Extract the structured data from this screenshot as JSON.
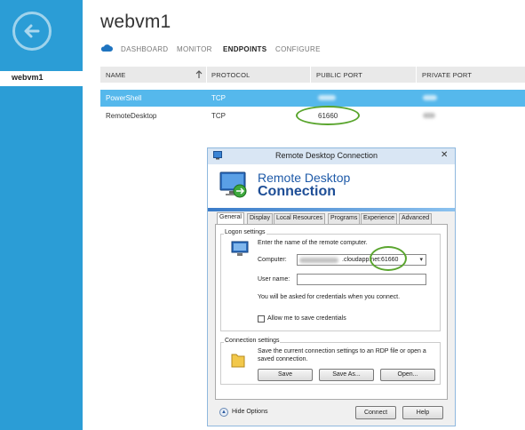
{
  "sidebar": {
    "back_icon": "back-arrow-icon",
    "selected_item": "webvm1"
  },
  "header": {
    "title": "webvm1",
    "tabs": [
      {
        "label": "DASHBOARD"
      },
      {
        "label": "MONITOR"
      },
      {
        "label": "ENDPOINTS"
      },
      {
        "label": "CONFIGURE"
      }
    ],
    "active_tab": "ENDPOINTS"
  },
  "table": {
    "columns": [
      "NAME",
      "PROTOCOL",
      "PUBLIC PORT",
      "PRIVATE PORT"
    ],
    "rows": [
      {
        "name": "PowerShell",
        "protocol": "TCP",
        "public_port": "",
        "private_port": ""
      },
      {
        "name": "RemoteDesktop",
        "protocol": "TCP",
        "public_port": "61660",
        "private_port": ""
      }
    ]
  },
  "dialog": {
    "title": "Remote Desktop Connection",
    "banner_line1": "Remote Desktop",
    "banner_line2": "Connection",
    "tabs": [
      "General",
      "Display",
      "Local Resources",
      "Programs",
      "Experience",
      "Advanced"
    ],
    "logon": {
      "group_label": "Logon settings",
      "instruction": "Enter the name of the remote computer.",
      "computer_label": "Computer:",
      "computer_value": ".cloudapp.net:61660",
      "username_label": "User name:",
      "username_value": "",
      "credentials_note": "You will be asked for credentials when you connect.",
      "save_credentials_label": "Allow me to save credentials"
    },
    "connection": {
      "group_label": "Connection settings",
      "description": "Save the current connection settings to an RDP file or open a saved connection.",
      "save_button": "Save",
      "save_as_button": "Save As...",
      "open_button": "Open..."
    },
    "hide_options": "Hide Options",
    "connect_button": "Connect",
    "help_button": "Help"
  },
  "colors": {
    "sidebar": "#2b9dd6",
    "selected_row": "#55b8ec",
    "highlight_oval": "#5aa52e",
    "rdp_blue": "#1e5aa8"
  }
}
